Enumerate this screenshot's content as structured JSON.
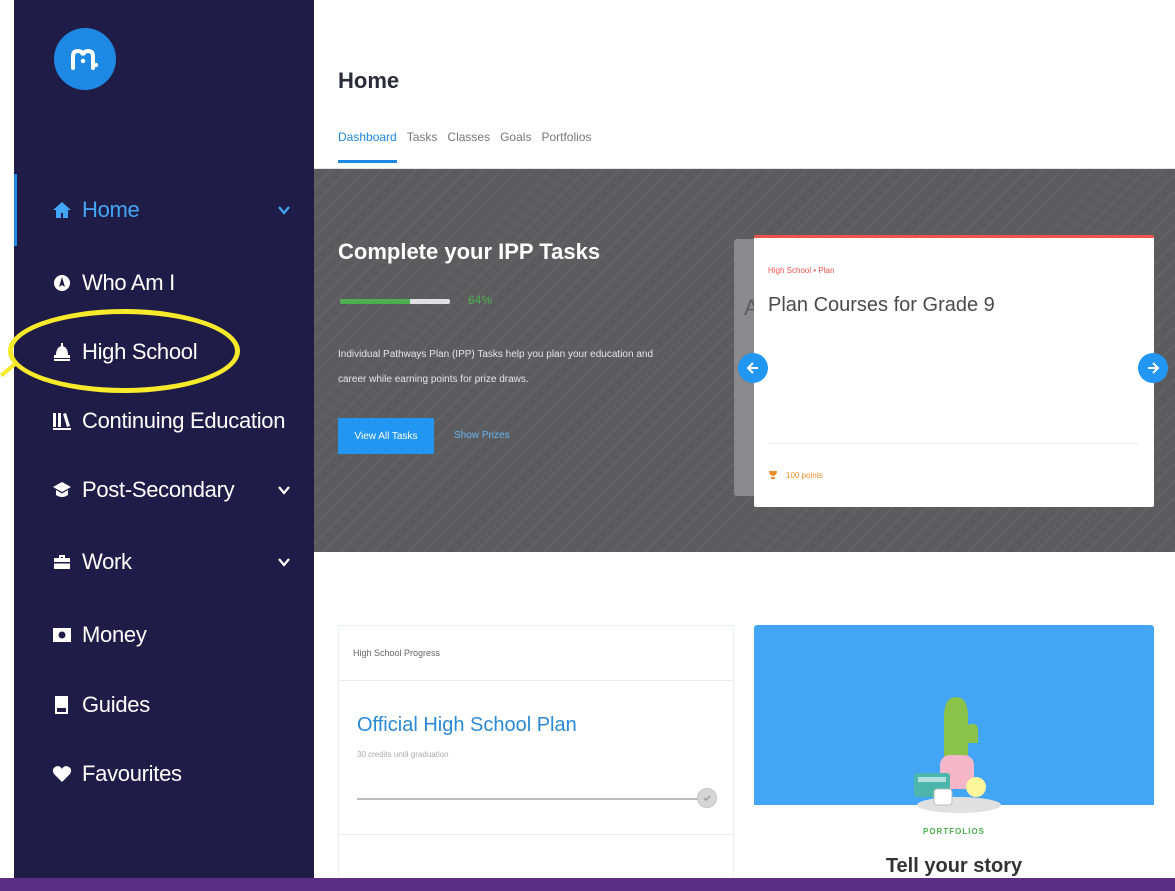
{
  "sidebar": {
    "items": [
      {
        "label": "Home",
        "icon": "home-icon",
        "has_chevron": true,
        "active": true
      },
      {
        "label": "Who Am I",
        "icon": "compass-icon",
        "has_chevron": false
      },
      {
        "label": "High School",
        "icon": "school-bell-icon",
        "has_chevron": false,
        "highlighted": true
      },
      {
        "label": "Continuing Education",
        "icon": "books-icon",
        "has_chevron": false
      },
      {
        "label": "Post-Secondary",
        "icon": "graduation-cap-icon",
        "has_chevron": true
      },
      {
        "label": "Work",
        "icon": "briefcase-icon",
        "has_chevron": true
      },
      {
        "label": "Money",
        "icon": "money-icon",
        "has_chevron": false
      },
      {
        "label": "Guides",
        "icon": "book-icon",
        "has_chevron": false
      },
      {
        "label": "Favourites",
        "icon": "heart-icon",
        "has_chevron": false
      }
    ]
  },
  "header": {
    "title": "Home",
    "tabs": [
      {
        "label": "Dashboard",
        "active": true
      },
      {
        "label": "Tasks"
      },
      {
        "label": "Classes"
      },
      {
        "label": "Goals"
      },
      {
        "label": "Portfolios"
      }
    ]
  },
  "hero": {
    "title": "Complete your IPP Tasks",
    "progress_percent": 64,
    "progress_text": "64%",
    "description": "Individual Pathways Plan (IPP) Tasks help you plan your education and career while earning points for prize draws.",
    "view_all_button": "View All Tasks",
    "show_prizes_link": "Show Prizes"
  },
  "task_card": {
    "eyebrow": "High School • Plan",
    "title": "Plan Courses for Grade 9",
    "points": "100 points",
    "behind_card_fragment": "A"
  },
  "progress_panel": {
    "header": "High School Progress",
    "title": "Official High School Plan",
    "subtitle": "30 credits until graduation"
  },
  "portfolio_panel": {
    "eyebrow": "PORTFOLIOS",
    "title": "Tell your story"
  },
  "colors": {
    "sidebar_bg": "#1f1d47",
    "accent": "#1e88e5",
    "highlight": "#f7ea2a",
    "progress_green": "#4caf50",
    "card_top_border": "#ef5350",
    "footer_band": "#5b2e86"
  }
}
